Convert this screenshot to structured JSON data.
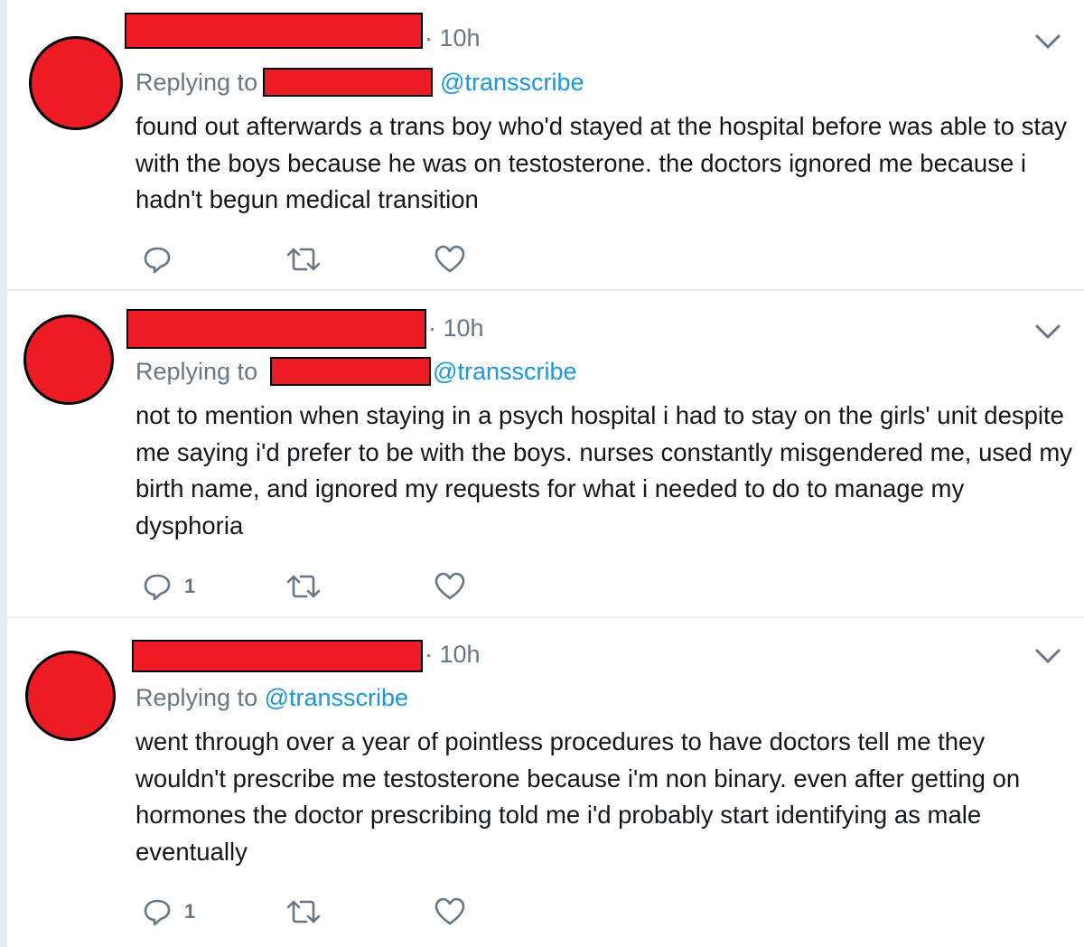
{
  "tweets": [
    {
      "time": "10h",
      "replying_prefix": "Replying to",
      "mention": "@transscribe",
      "text": "found out afterwards a trans boy who'd stayed at the hospital before was able to stay with the boys because he was on testosterone. the doctors ignored me because i hadn't begun medical transition",
      "reply_count": "",
      "icons": [
        "reply-icon",
        "retweet-icon",
        "like-icon",
        "chevron-down-icon"
      ]
    },
    {
      "time": "10h",
      "replying_prefix": "Replying to",
      "mention": "@transscribe",
      "text": "not to mention when staying in a psych hospital i had to stay on the girls' unit despite me saying i'd prefer to be with the boys. nurses constantly misgendered me, used my birth name, and ignored my requests for what i needed to do to manage my dysphoria",
      "reply_count": "1",
      "icons": [
        "reply-icon",
        "retweet-icon",
        "like-icon",
        "chevron-down-icon"
      ]
    },
    {
      "time": "10h",
      "replying_prefix": "Replying to",
      "mention": "@transscribe",
      "text": "went through over a year of pointless procedures to have doctors tell me they wouldn't prescribe me testosterone because i'm non binary. even after getting on hormones the doctor prescribing told me i'd probably start identifying as male eventually",
      "reply_count": "1",
      "icons": [
        "reply-icon",
        "retweet-icon",
        "like-icon",
        "chevron-down-icon"
      ]
    }
  ],
  "colors": {
    "redaction": "#ed1c24",
    "mention": "#1b95e0",
    "secondary_text": "#657786",
    "background": "#e6ecf0"
  }
}
